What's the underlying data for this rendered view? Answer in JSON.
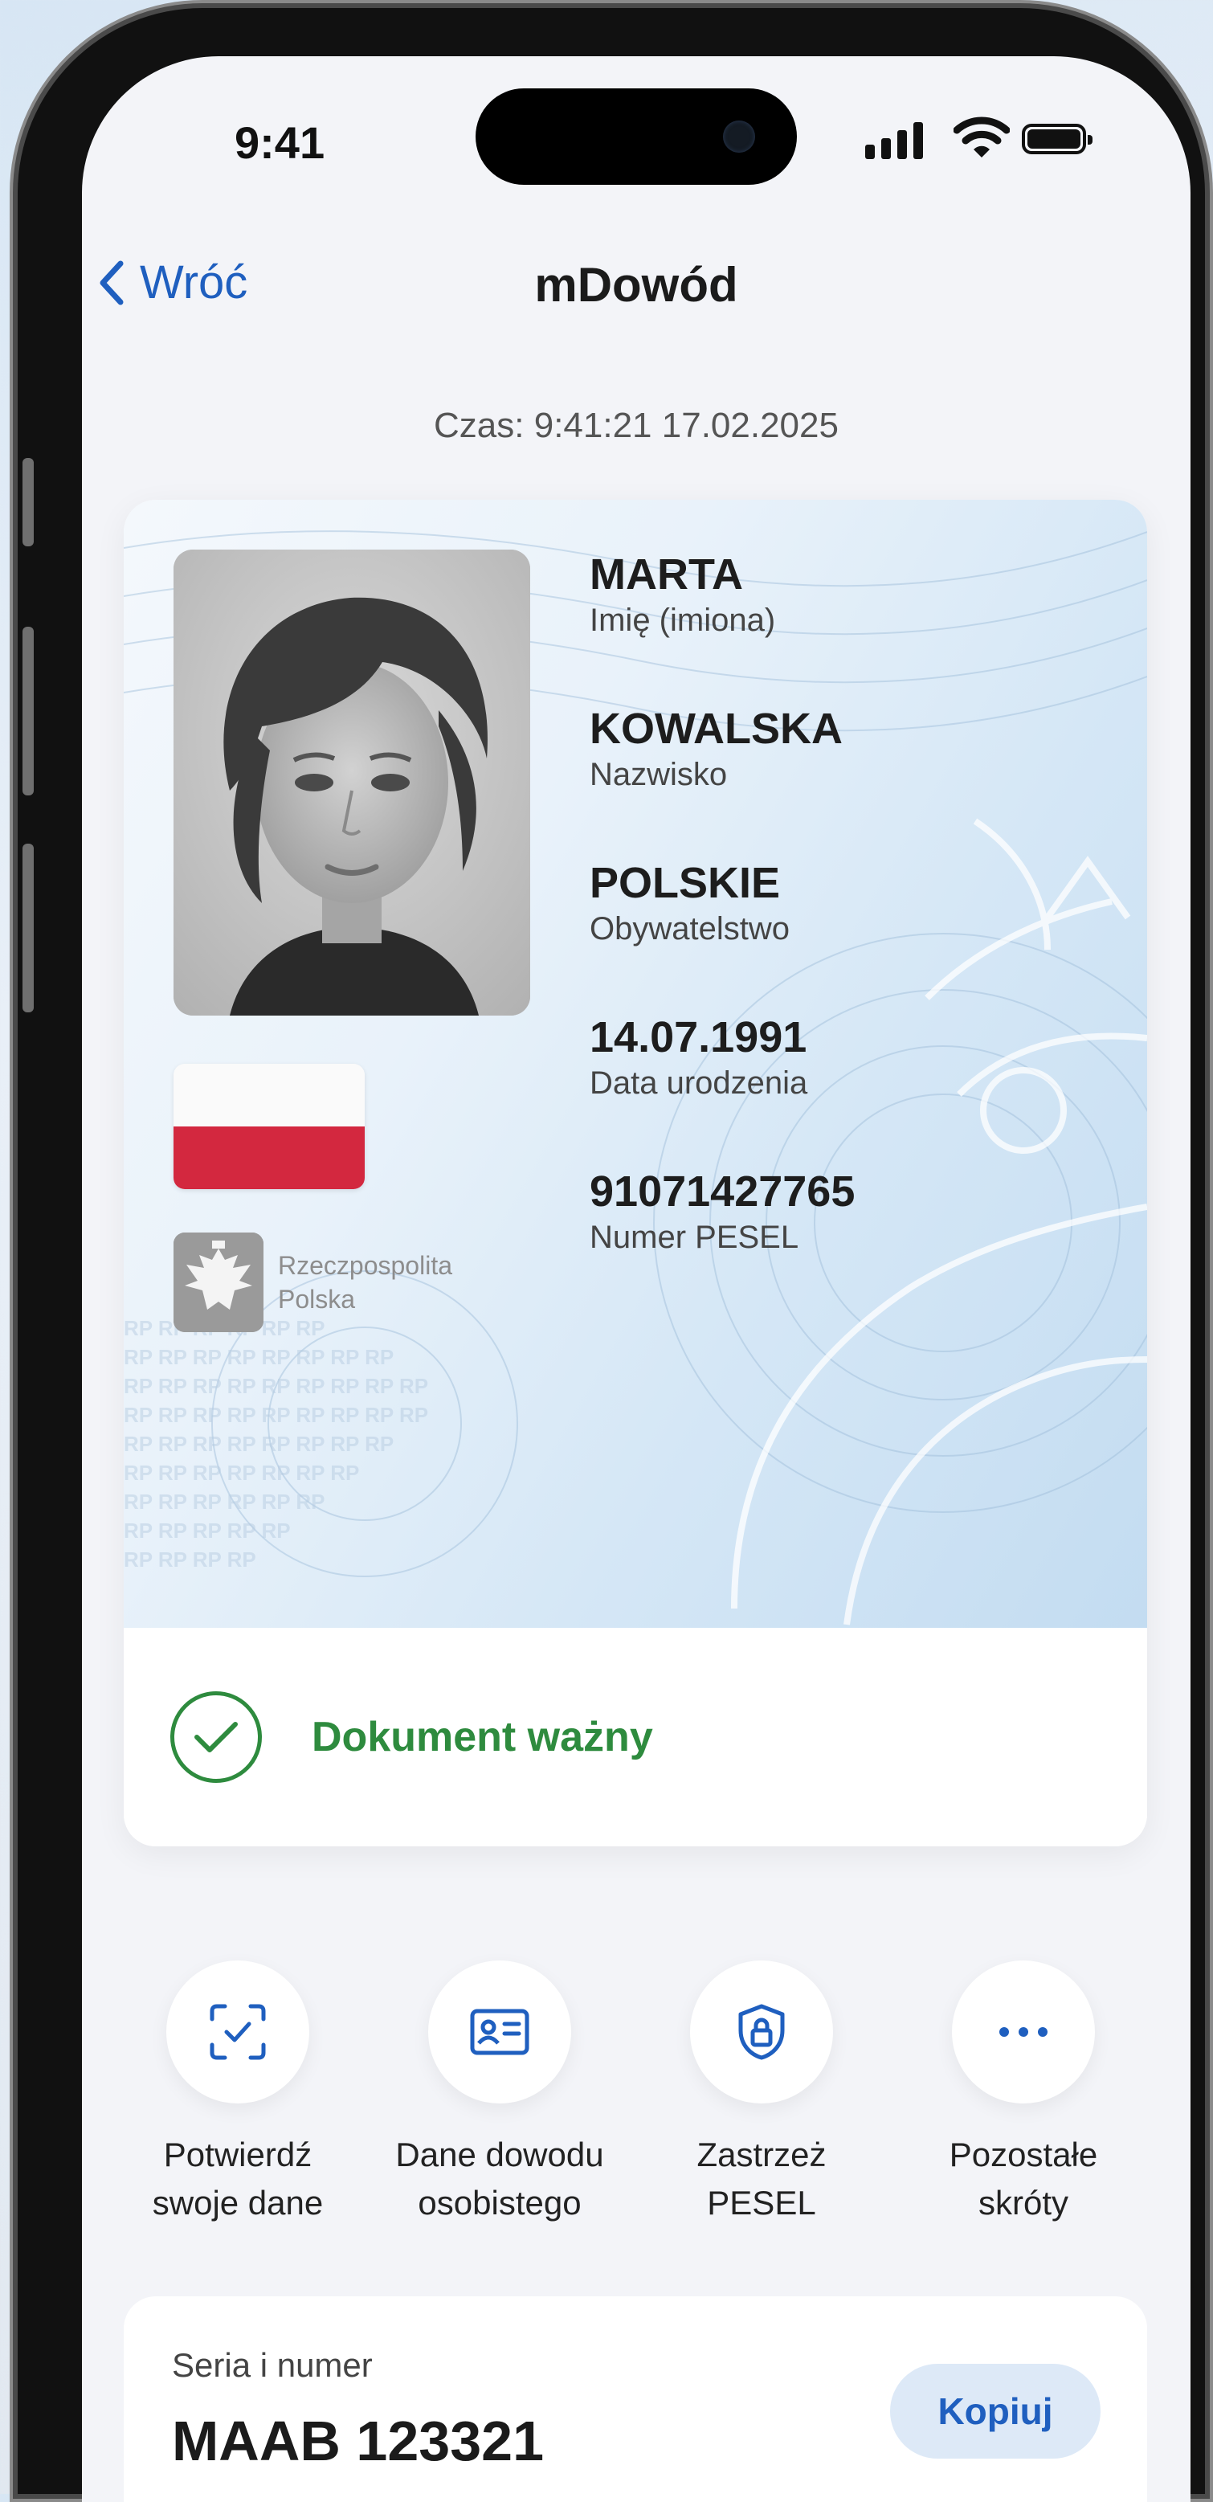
{
  "status_bar": {
    "time": "9:41"
  },
  "nav": {
    "back_label": "Wróć",
    "title": "mDowód"
  },
  "card": {
    "check_time": "Czas: 9:41:21 17.02.2025",
    "fields": [
      {
        "value": "MARTA",
        "label": "Imię (imiona)"
      },
      {
        "value": "KOWALSKA",
        "label": "Nazwisko"
      },
      {
        "value": "POLSKIE",
        "label": "Obywatelstwo"
      },
      {
        "value": "14.07.1991",
        "label": "Data urodzenia"
      },
      {
        "value": "91071427765",
        "label": "Numer PESEL"
      }
    ],
    "emblem_text_line1": "Rzeczpospolita",
    "emblem_text_line2": "Polska",
    "status": "Dokument ważny"
  },
  "shortcuts": [
    {
      "line1": "Potwierdź",
      "line2": "swoje dane",
      "icon": "scan-check-icon"
    },
    {
      "line1": "Dane dowodu",
      "line2": "osobistego",
      "icon": "id-card-icon"
    },
    {
      "line1": "Zastrzeż",
      "line2": "PESEL",
      "icon": "shield-lock-icon"
    },
    {
      "line1": "Pozostałe",
      "line2": "skróty",
      "icon": "more-icon"
    }
  ],
  "document": {
    "label": "Seria i numer",
    "value": "MAAB 123321",
    "copy_label": "Kopiuj"
  },
  "colors": {
    "accent": "#1f5fbf",
    "valid_green": "#2e8b3e",
    "flag_red": "#d3283f"
  }
}
